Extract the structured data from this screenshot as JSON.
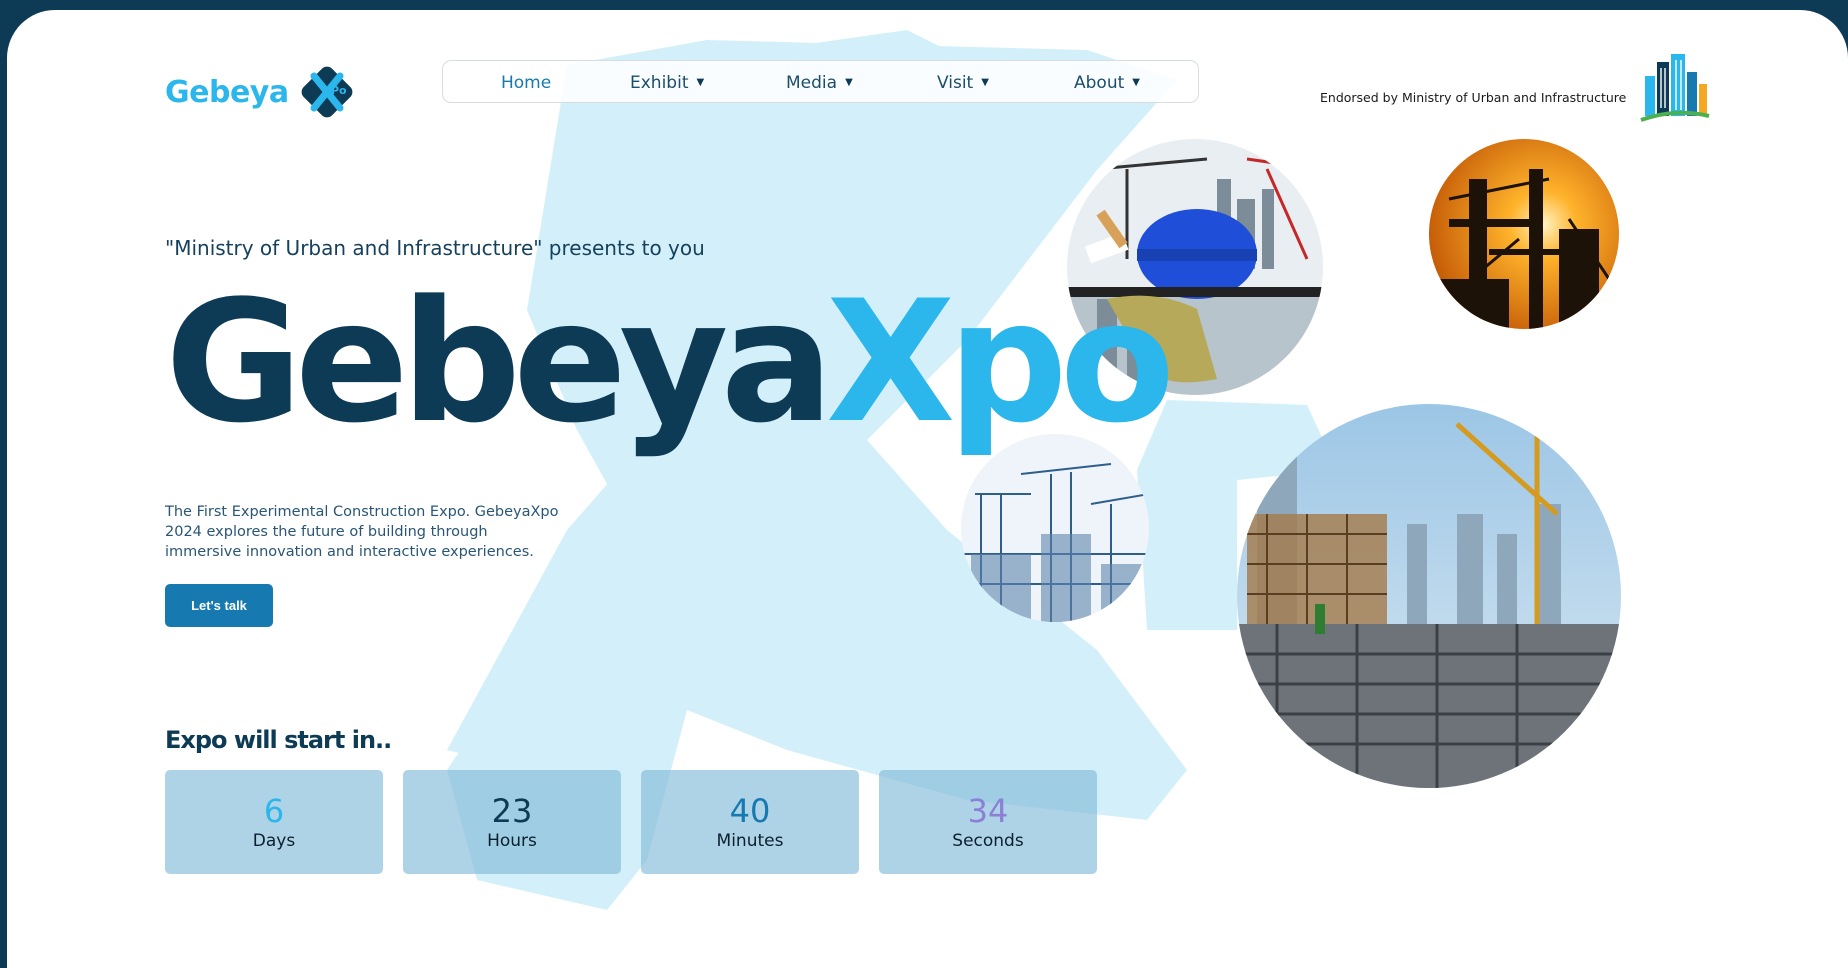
{
  "brand": {
    "logo_text": "Gebeya",
    "logo_mark_letters": "Xpo",
    "endorsement": "Endorsed by Ministry of Urban and Infrastructure"
  },
  "nav": {
    "items": [
      {
        "label": "Home",
        "active": true,
        "has_dropdown": false
      },
      {
        "label": "Exhibit",
        "active": false,
        "has_dropdown": true
      },
      {
        "label": "Media",
        "active": false,
        "has_dropdown": true
      },
      {
        "label": "Visit",
        "active": false,
        "has_dropdown": true
      },
      {
        "label": "About",
        "active": false,
        "has_dropdown": true
      }
    ]
  },
  "hero": {
    "presents": "\"Ministry of Urban and Infrastructure\" presents to you",
    "title_part1": "Gebeya",
    "title_part2": "Xpo",
    "description": "The First Experimental Construction Expo. GebeyaXpo 2024 explores the future of building through immersive innovation and interactive experiences.",
    "cta_label": "Let's talk"
  },
  "countdown": {
    "title": "Expo will start in..",
    "units": [
      {
        "value": "6",
        "label": "Days",
        "color": "#2bb6ec"
      },
      {
        "value": "23",
        "label": "Hours",
        "color": "#0d3a55"
      },
      {
        "value": "40",
        "label": "Minutes",
        "color": "#1679b0"
      },
      {
        "value": "34",
        "label": "Seconds",
        "color": "#8b7fd6"
      }
    ]
  },
  "colors": {
    "navy": "#0d3a55",
    "cyan": "#2bb6ec",
    "button": "#1679b0",
    "bg_shape": "#d3f0fa"
  },
  "images": [
    "construction-tools-photo",
    "sunset-crane-photo",
    "blueprint-cranes-photo",
    "construction-site-photo"
  ]
}
